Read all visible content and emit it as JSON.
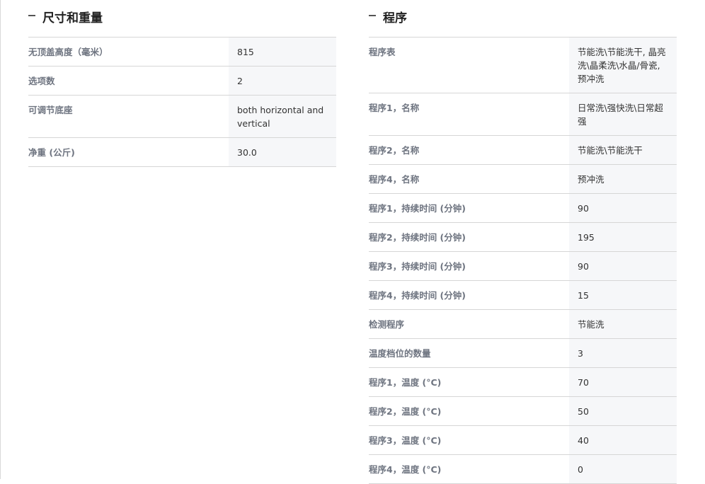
{
  "dimensions": {
    "title": "尺寸和重量",
    "rows": [
      {
        "label": "无顶盖高度（毫米）",
        "value": "815"
      },
      {
        "label": "选项数",
        "value": "2"
      },
      {
        "label": "可调节底座",
        "value": "both horizontal and vertical"
      },
      {
        "label": "净重 (公斤)",
        "value": "30.0"
      }
    ]
  },
  "programs": {
    "title": "程序",
    "rows": [
      {
        "label": "程序表",
        "value": "节能洗\\节能洗干, 晶亮洗\\晶柔洗\\水晶/骨瓷, 预冲洗"
      },
      {
        "label": "程序1，名称",
        "value": "日常洗\\强快洗\\日常超强"
      },
      {
        "label": "程序2，名称",
        "value": "节能洗\\节能洗干"
      },
      {
        "label": "程序4，名称",
        "value": "预冲洗"
      },
      {
        "label": "程序1，持续时间 (分钟)",
        "value": "90"
      },
      {
        "label": "程序2，持续时间 (分钟)",
        "value": "195"
      },
      {
        "label": "程序3，持续时间 (分钟)",
        "value": "90"
      },
      {
        "label": "程序4，持续时间 (分钟)",
        "value": "15"
      },
      {
        "label": "检测程序",
        "value": "节能洗"
      },
      {
        "label": "温度档位的数量",
        "value": "3"
      },
      {
        "label": "程序1，温度 (°C)",
        "value": "70"
      },
      {
        "label": "程序2，温度 (°C)",
        "value": "50"
      },
      {
        "label": "程序3，温度 (°C)",
        "value": "40"
      },
      {
        "label": "程序4，温度 (°C)",
        "value": "0"
      }
    ]
  },
  "icons": {
    "collapse": "minus-collapse-icon"
  }
}
